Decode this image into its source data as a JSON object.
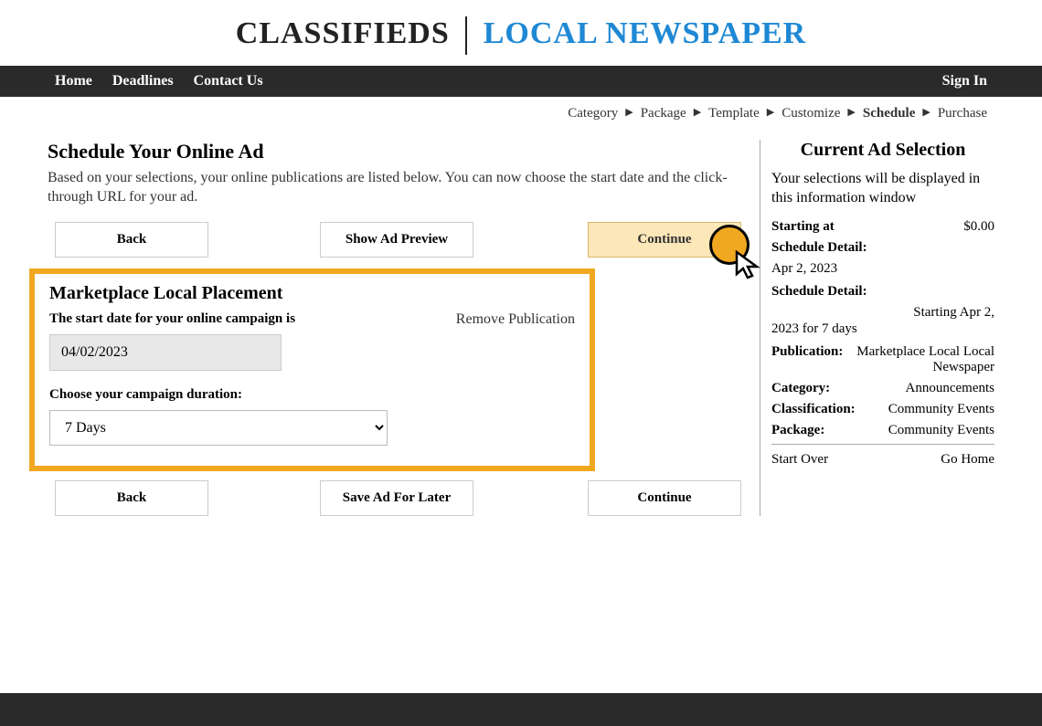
{
  "header": {
    "classifieds": "CLASSIFIEDS",
    "newspaper": "LOCAL NEWSPAPER"
  },
  "nav": {
    "home": "Home",
    "deadlines": "Deadlines",
    "contact": "Contact Us",
    "signin": "Sign In"
  },
  "breadcrumb": {
    "category": "Category",
    "package": "Package",
    "template": "Template",
    "customize": "Customize",
    "schedule": "Schedule",
    "purchase": "Purchase"
  },
  "page": {
    "title": "Schedule Your Online Ad",
    "description": "Based on your selections, your online publications are listed below. You can now choose the start date and the click-through URL for your ad."
  },
  "buttons": {
    "back": "Back",
    "show_preview": "Show Ad Preview",
    "continue": "Continue",
    "save_later": "Save Ad For Later"
  },
  "placement": {
    "title": "Marketplace Local Placement",
    "start_date_label": "The start date for your online campaign is",
    "remove": "Remove Publication",
    "date_value": "04/02/2023",
    "duration_label": "Choose your campaign duration:",
    "duration_value": "7 Days"
  },
  "sidebar": {
    "title": "Current Ad Selection",
    "description": "Your selections will be displayed in this information window",
    "starting_at_label": "Starting at",
    "starting_at_value": "$0.00",
    "schedule_detail_label": "Schedule Detail:",
    "schedule_detail_date": "Apr 2, 2023",
    "schedule_detail2_right": "Starting Apr 2,",
    "schedule_detail2_left": "2023 for 7 days",
    "publication_label": "Publication:",
    "publication_value": "Marketplace Local Local Newspaper",
    "category_label": "Category:",
    "category_value": "Announcements",
    "classification_label": "Classification:",
    "classification_value": "Community Events",
    "package_label": "Package:",
    "package_value": "Community Events",
    "start_over": "Start Over",
    "go_home": "Go Home"
  }
}
